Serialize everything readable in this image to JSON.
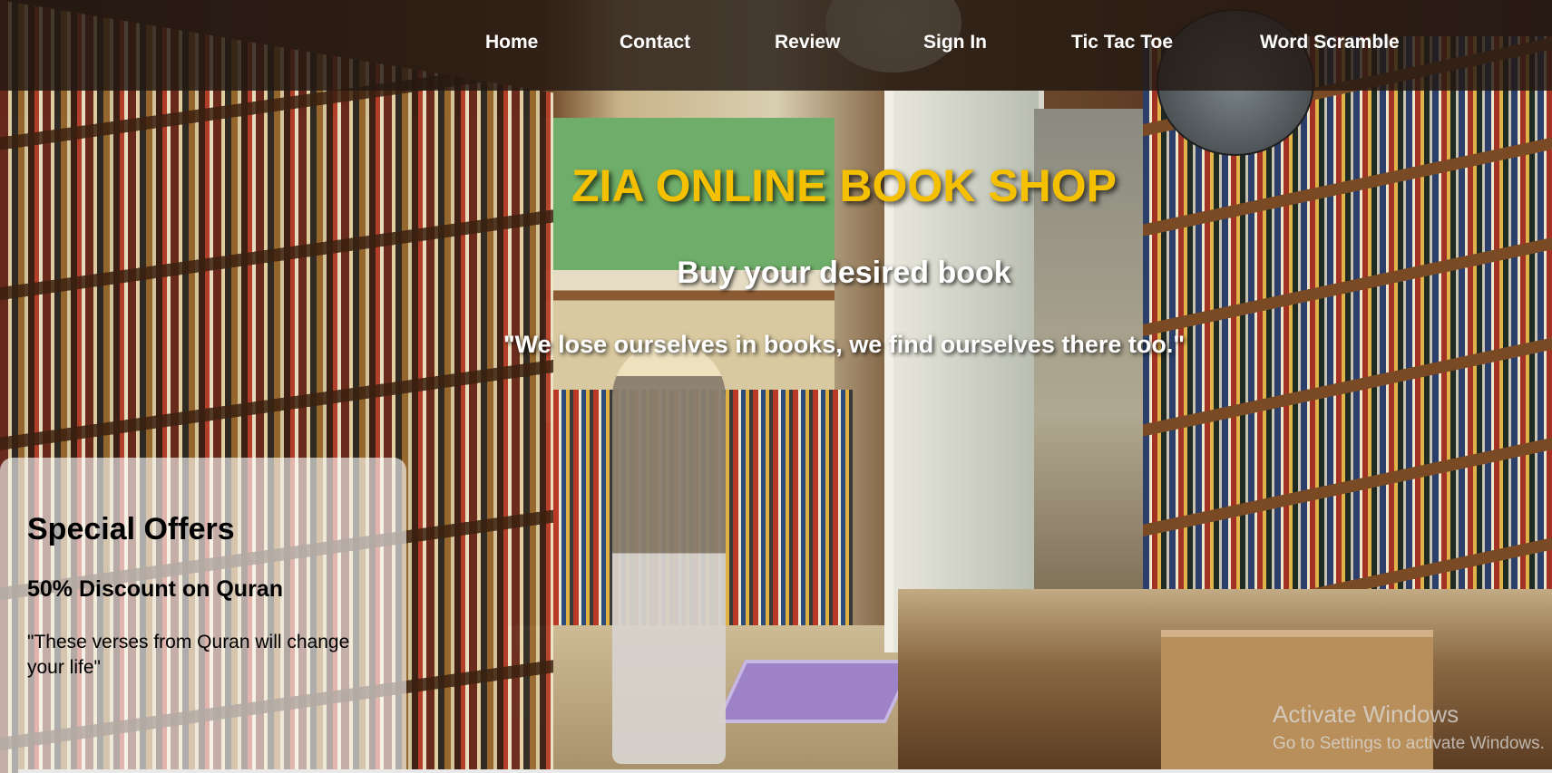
{
  "nav": {
    "links": [
      "Home",
      "Contact",
      "Review",
      "Sign In",
      "Tic Tac Toe",
      "Word Scramble"
    ]
  },
  "hero": {
    "title": "ZIA ONLINE BOOK SHOP",
    "subtitle": "Buy your desired book",
    "quote": "\"We lose ourselves in books, we find ourselves there too.\""
  },
  "offers": {
    "title": "Special Offers",
    "item": "50% Discount on Quran",
    "text": "\"These verses from Quran will change your life\""
  },
  "watermark": {
    "title": "Activate Windows",
    "subtitle": "Go to Settings to activate Windows."
  },
  "colors": {
    "title": "#f5c000",
    "navbar": "#231912"
  }
}
